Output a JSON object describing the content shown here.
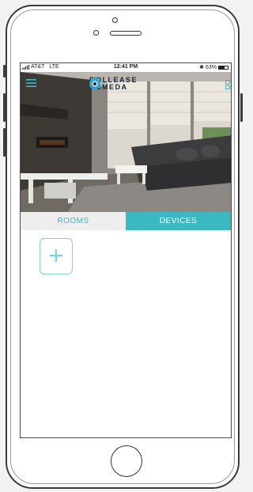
{
  "status_bar": {
    "carrier": "AT&T",
    "network": "LTE",
    "time": "12:41 PM",
    "bluetooth_icon": "bluetooth-icon",
    "battery": "63%",
    "battery_level": 0.63
  },
  "header": {
    "menu_icon": "hamburger-menu-icon",
    "logo_line1": "ROLLEASE",
    "logo_line2": "ACMEDA",
    "view_icon": "grid-view-icon"
  },
  "tabs": [
    {
      "label": "ROOMS",
      "active": false
    },
    {
      "label": "DEVICES",
      "active": true
    }
  ],
  "add_button": {
    "label": "+"
  },
  "colors": {
    "accent": "#3ab9c3",
    "accent_light": "#7fd3da",
    "tab_inactive_bg": "#eeeeee"
  }
}
